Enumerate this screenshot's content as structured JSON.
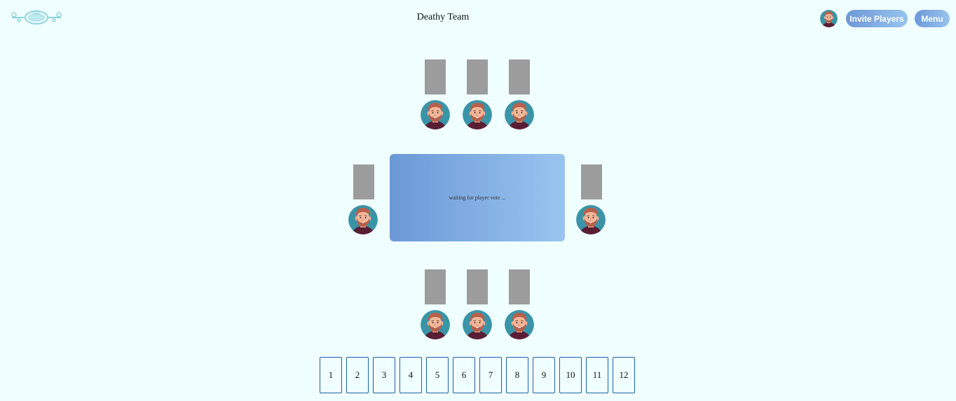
{
  "header": {
    "team_name": "Deathy Team",
    "invite_label": "Invite Players",
    "menu_label": "Menu"
  },
  "table": {
    "status": "waiting for player vote ..."
  },
  "vote_cards": [
    "1",
    "2",
    "3",
    "4",
    "5",
    "6",
    "7",
    "8",
    "9",
    "10",
    "11",
    "12"
  ],
  "colors": {
    "background": "#f0ffff",
    "button_gradient_start": "#6d98d8",
    "button_gradient_end": "#97c4ee",
    "card_back": "#9c9c9c",
    "vote_card_border": "#1f5fa8",
    "avatar_bg": "#3a94a8"
  }
}
